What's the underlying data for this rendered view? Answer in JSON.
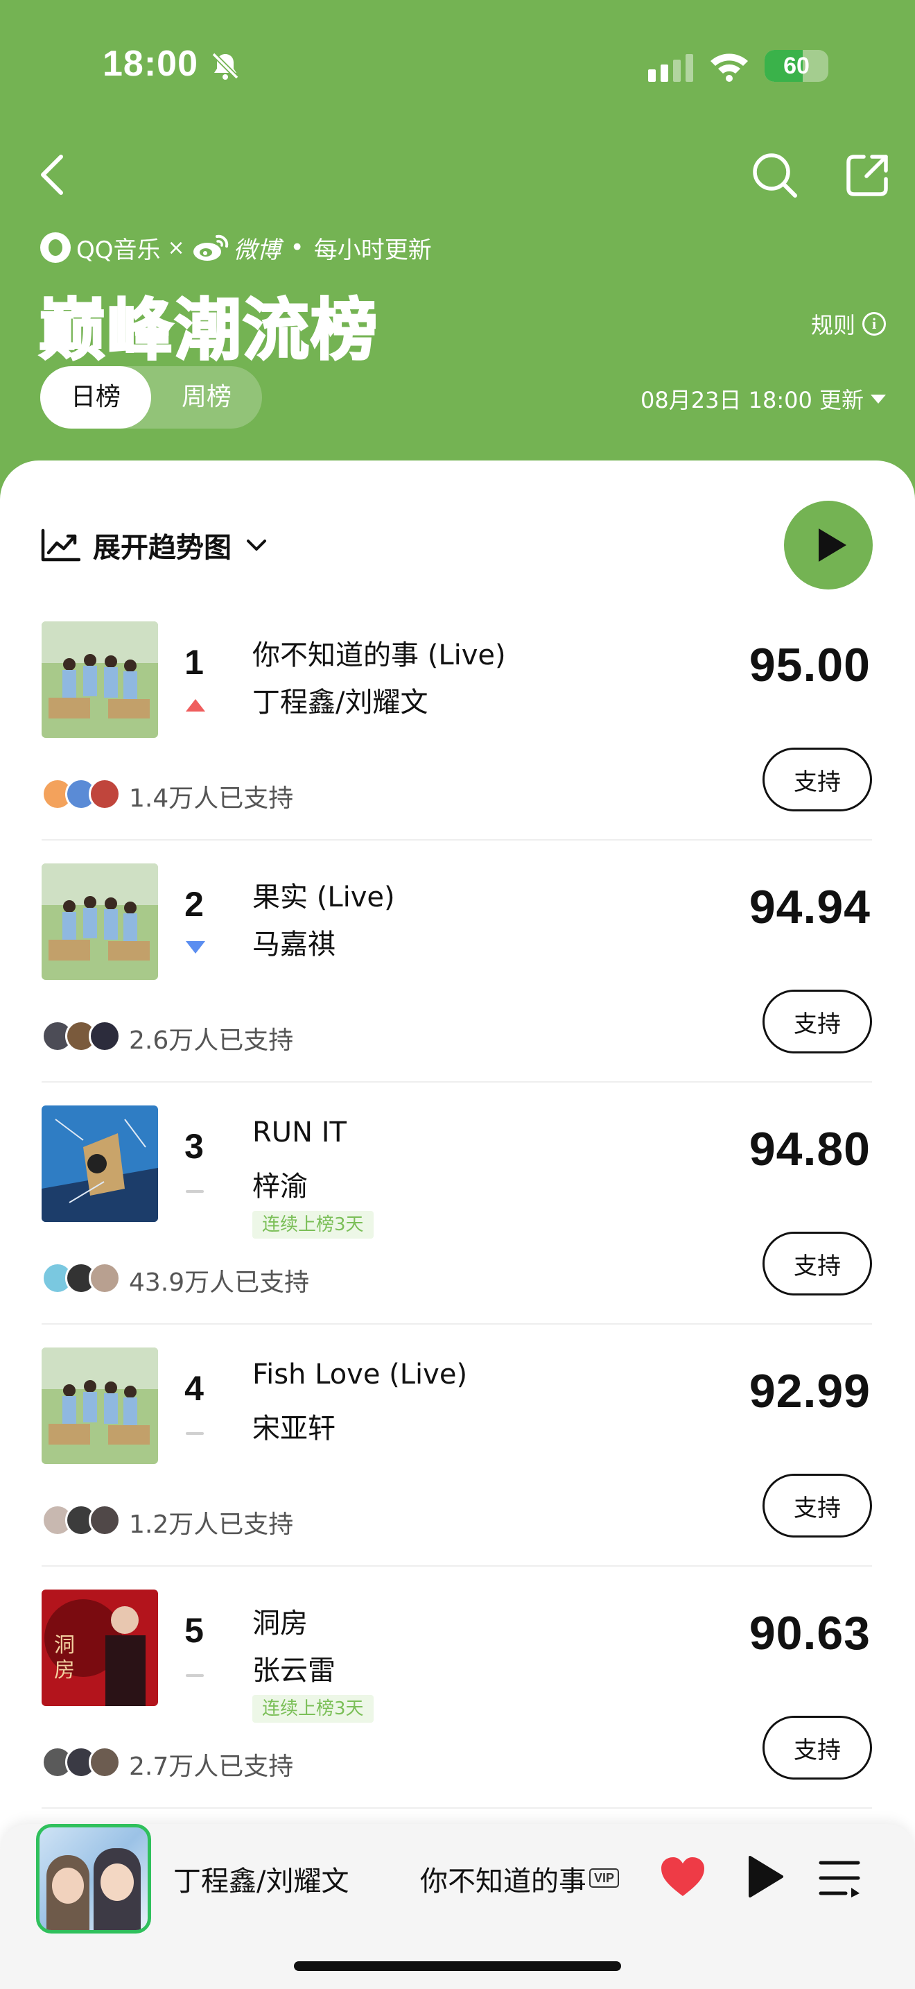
{
  "status_bar": {
    "time": "18:00",
    "battery": 60,
    "battery_label": "60"
  },
  "header": {
    "brand_qq": "QQ音乐",
    "brand_times": "×",
    "brand_weibo": "微博",
    "brand_dot": "•",
    "update_freq": "每小时更新",
    "title": "巅峰潮流榜",
    "rules_label": "规则",
    "tabs": [
      {
        "label": "日榜",
        "active": true
      },
      {
        "label": "周榜",
        "active": false
      }
    ],
    "updated_label": "08月23日 18:00 更新"
  },
  "list_header": {
    "trend_toggle_label": "展开趋势图"
  },
  "songs": [
    {
      "rank": "1",
      "trend": "up",
      "title": "你不知道的事 (Live)",
      "artist": "丁程鑫/刘耀文",
      "score": "95.00",
      "supporters": "1.4万人已支持",
      "support_label": "支持",
      "streak": ""
    },
    {
      "rank": "2",
      "trend": "down",
      "title": "果实 (Live)",
      "artist": "马嘉祺",
      "score": "94.94",
      "supporters": "2.6万人已支持",
      "support_label": "支持",
      "streak": ""
    },
    {
      "rank": "3",
      "trend": "same",
      "title": "RUN IT",
      "artist": "梓渝",
      "score": "94.80",
      "supporters": "43.9万人已支持",
      "support_label": "支持",
      "streak": "连续上榜3天"
    },
    {
      "rank": "4",
      "trend": "same",
      "title": "Fish Love (Live)",
      "artist": "宋亚轩",
      "score": "92.99",
      "supporters": "1.2万人已支持",
      "support_label": "支持",
      "streak": ""
    },
    {
      "rank": "5",
      "trend": "same",
      "title": "洞房",
      "artist": "张云雷",
      "score": "90.63",
      "supporters": "2.7万人已支持",
      "support_label": "支持",
      "streak": "连续上榜3天"
    }
  ],
  "player": {
    "artist": "丁程鑫/刘耀文",
    "song_title": "你不知道的事",
    "vip_label": "VIP"
  },
  "colors": {
    "brand_green": "#74b353",
    "trend_up": "#ef5d5d",
    "trend_down": "#5b8ef0",
    "heart": "#ee3b46"
  }
}
